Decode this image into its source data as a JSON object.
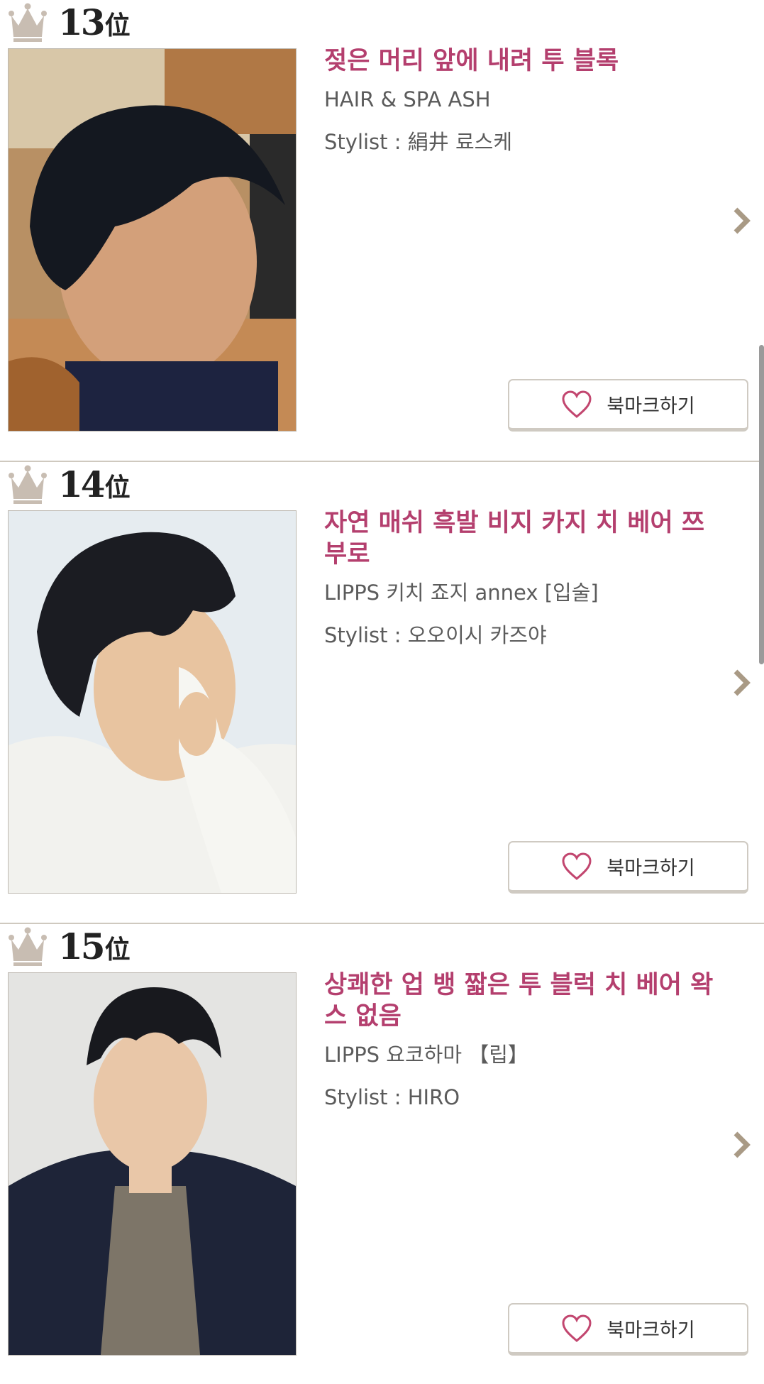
{
  "items": [
    {
      "rank": "13",
      "rank_suffix": "位",
      "title": "젖은 머리 앞에 내려 투 블록",
      "salon": "HAIR & SPA ASH",
      "stylist": "Stylist : 絹井 료스케",
      "bookmark_label": "북마크하기",
      "icons": {
        "rank": "crown-icon",
        "next": "chevron-right-icon",
        "bookmark": "heart-icon"
      }
    },
    {
      "rank": "14",
      "rank_suffix": "位",
      "title": "자연 매쉬 흑발 비지 카지 치 베어 쯔부로",
      "salon": "LIPPS 키치 죠지 annex [입술]",
      "stylist": "Stylist : 오오이시 카즈야",
      "bookmark_label": "북마크하기",
      "icons": {
        "rank": "crown-icon",
        "next": "chevron-right-icon",
        "bookmark": "heart-icon"
      }
    },
    {
      "rank": "15",
      "rank_suffix": "位",
      "title": "상쾌한 업 뱅 짧은 투 블럭 치 베어 왁스 없음",
      "salon": "LIPPS 요코하마 【립】",
      "stylist": "Stylist : HIRO",
      "bookmark_label": "북마크하기",
      "icons": {
        "rank": "crown-icon",
        "next": "chevron-right-icon",
        "bookmark": "heart-icon"
      }
    }
  ],
  "colors": {
    "title": "#b43f6e",
    "heart": "#c2466f",
    "crown": "#c8bdb2",
    "chevron": "#a99a85"
  }
}
